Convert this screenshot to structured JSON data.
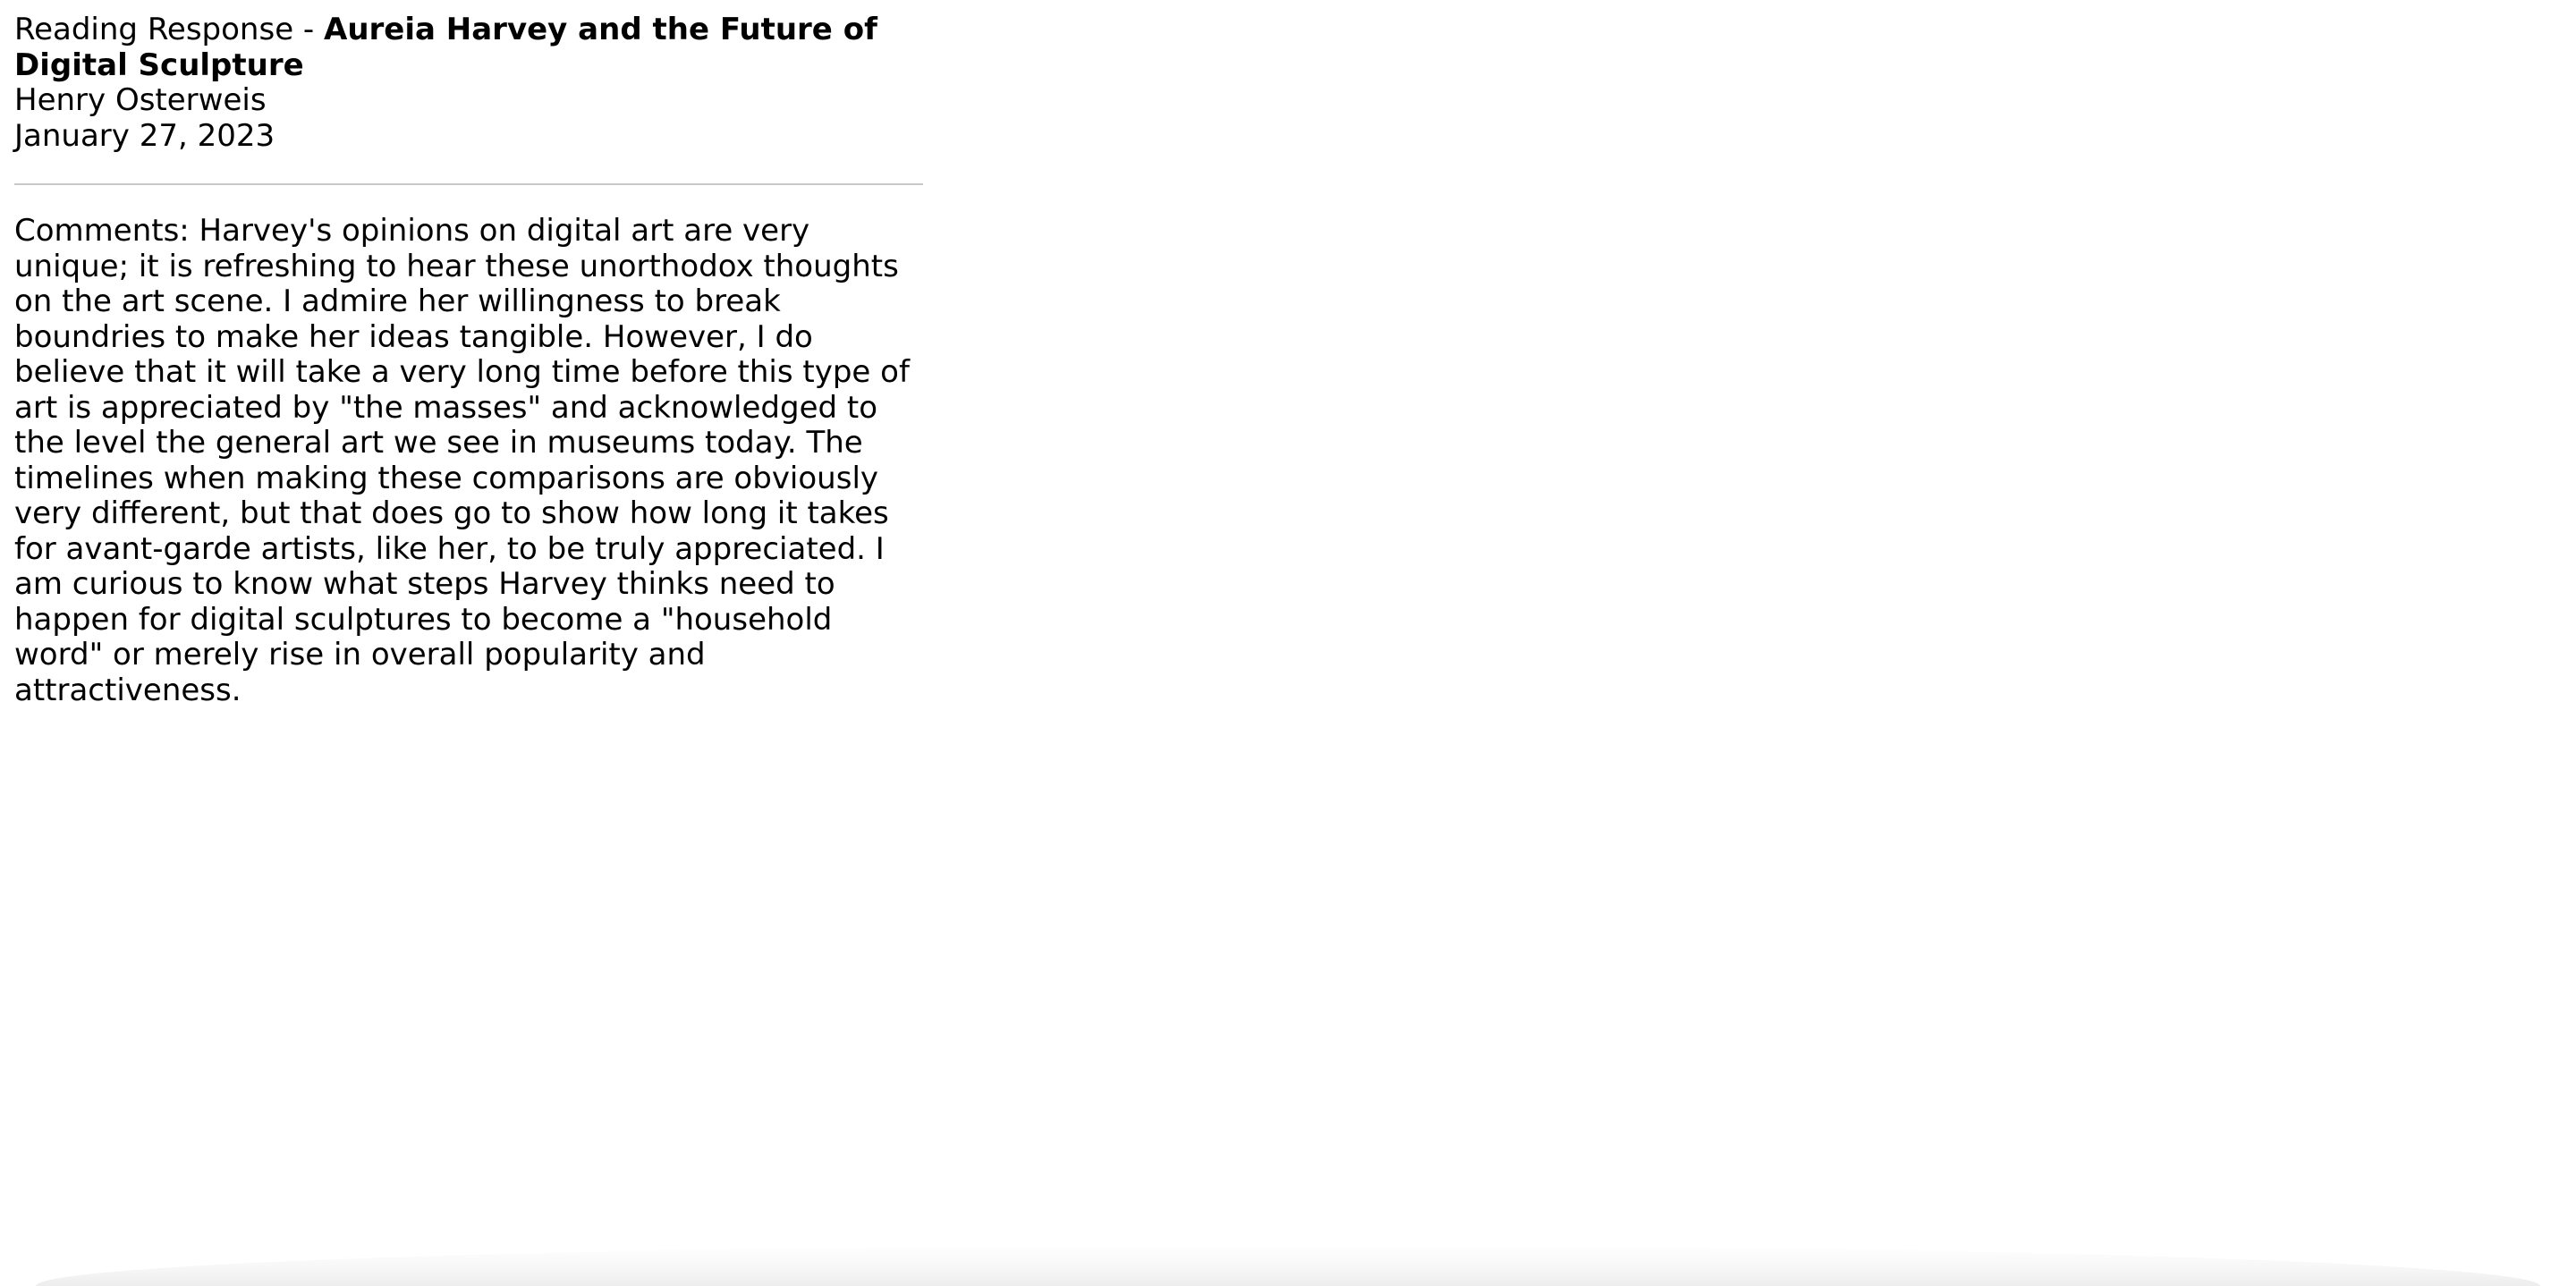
{
  "header": {
    "title_prefix": "Reading Response - ",
    "title_bold": "Aureia Harvey and the Future of Digital Sculpture",
    "author": "Henry Osterweis",
    "date": "January 27, 2023"
  },
  "body": {
    "comments": "Comments: Harvey's opinions on digital art are very unique; it is refreshing to hear these unorthodox thoughts on the art scene. I admire her willingness to break boundries to make her ideas tangible. However, I do believe that it will take a very long time before this type of art is appreciated by \"the masses\" and acknowledged to the level the general art we see in museums today. The timelines when making these comparisons are obviously very different, but that does go to show how long it takes for avant-garde artists, like her, to be truly appreciated. I am curious to know what steps Harvey thinks need to happen for digital sculptures to become a \"household word\" or merely rise in overall popularity and attractiveness."
  }
}
